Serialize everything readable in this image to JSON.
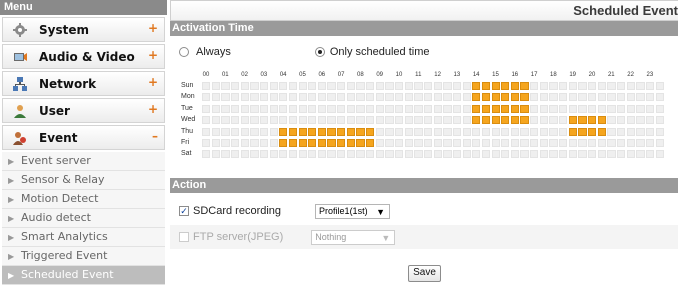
{
  "sidebar": {
    "header": "Menu",
    "items": [
      {
        "label": "System",
        "icon": "system-icon",
        "sign": "+"
      },
      {
        "label": "Audio & Video",
        "icon": "audio-video-icon",
        "sign": "+"
      },
      {
        "label": "Network",
        "icon": "network-icon",
        "sign": "+"
      },
      {
        "label": "User",
        "icon": "user-icon",
        "sign": "+"
      },
      {
        "label": "Event",
        "icon": "event-icon",
        "sign": "–"
      }
    ],
    "subitems": [
      {
        "label": "Event server"
      },
      {
        "label": "Sensor & Relay"
      },
      {
        "label": "Motion Detect"
      },
      {
        "label": "Audio detect"
      },
      {
        "label": "Smart Analytics"
      },
      {
        "label": "Triggered Event"
      },
      {
        "label": "Scheduled Event",
        "selected": true
      }
    ]
  },
  "main": {
    "title": "Scheduled Event",
    "activation": {
      "header": "Activation Time",
      "always_label": "Always",
      "scheduled_label": "Only scheduled time",
      "selected": "scheduled"
    },
    "schedule": {
      "hours": [
        "00",
        "01",
        "02",
        "03",
        "04",
        "05",
        "06",
        "07",
        "08",
        "09",
        "10",
        "11",
        "12",
        "13",
        "14",
        "15",
        "16",
        "17",
        "18",
        "19",
        "20",
        "21",
        "22",
        "23"
      ],
      "days": [
        "Sun",
        "Mon",
        "Tue",
        "Wed",
        "Thu",
        "Fri",
        "Sat"
      ],
      "active": {
        "Sun": [
          14,
          15,
          16
        ],
        "Mon": [
          14,
          15,
          16
        ],
        "Tue": [
          14,
          15,
          16
        ],
        "Wed": [
          14,
          15,
          16,
          19,
          20
        ],
        "Thu": [
          4,
          5,
          6,
          7,
          8,
          19,
          20
        ],
        "Fri": [
          4,
          5,
          6,
          7,
          8
        ],
        "Sat": []
      }
    },
    "action": {
      "header": "Action",
      "sdcard": {
        "label": "SDCard recording",
        "checked": true,
        "select_value": "Profile1(1st)"
      },
      "ftp": {
        "label": "FTP server(JPEG)",
        "checked": false,
        "select_value": "Nothing",
        "disabled": true
      }
    },
    "save_label": "Save"
  },
  "colors": {
    "active_cell": "#f5a51e",
    "inactive_cell": "#efefef",
    "section_bar": "#9a9a9a",
    "plus_sign": "#e07820"
  }
}
